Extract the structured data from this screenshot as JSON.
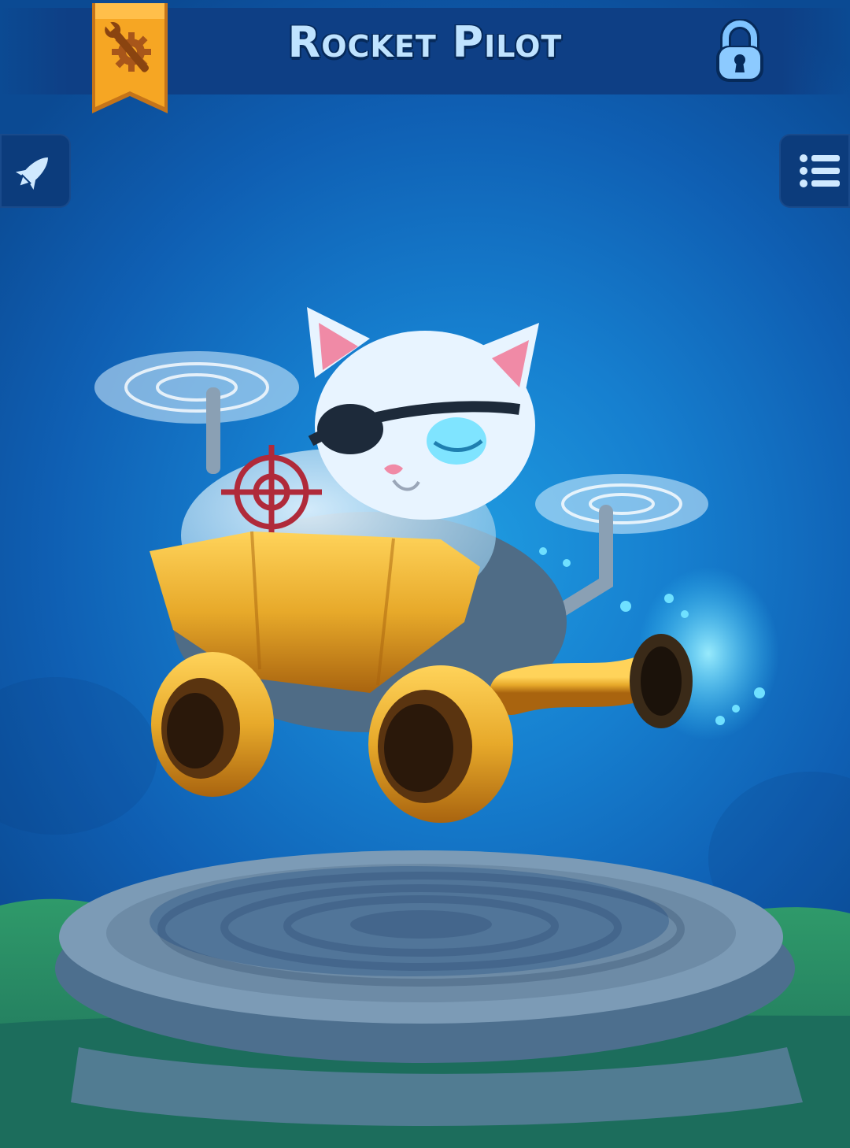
{
  "header": {
    "title": "Rocket Pilot",
    "badge_icon": "wrench-gear-icon",
    "lock_icon": "padlock-icon"
  },
  "buttons": {
    "left_icon": "rocket-icon",
    "right_icon": "list-menu-icon"
  },
  "colors": {
    "background": "#167fcf",
    "header_bar": "#0e3f85",
    "title_text": "#bfe3ff",
    "badge": "#f6a623",
    "vehicle_gold": "#e7a92a",
    "thruster_glow": "#3fd4ff"
  }
}
